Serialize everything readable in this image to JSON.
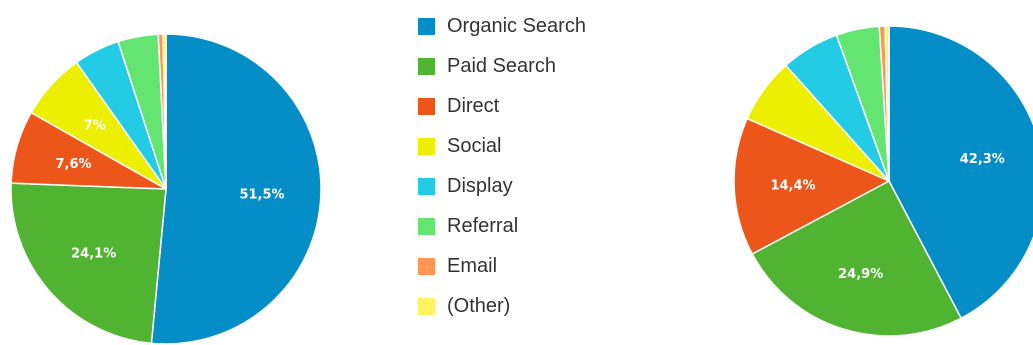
{
  "chart_data": [
    {
      "type": "pie",
      "labels": [
        "Organic Search",
        "Paid Search",
        "Direct",
        "Social",
        "Display",
        "Referral",
        "Email",
        "(Other)"
      ],
      "values": [
        51.5,
        24.1,
        7.6,
        7.0,
        4.8,
        4.2,
        0.5,
        0.3
      ],
      "data_labels": [
        "51,5%",
        "24,1%",
        "7,6%",
        "7%",
        "",
        "",
        "",
        ""
      ],
      "colors": [
        "#058DC7",
        "#50B432",
        "#ED561B",
        "#EDEF00",
        "#24CBE5",
        "#64E572",
        "#FF9655",
        "#FFF263"
      ]
    },
    {
      "type": "pie",
      "labels": [
        "Organic Search",
        "Paid Search",
        "Direct",
        "Social",
        "Display",
        "Referral",
        "Email",
        "(Other)"
      ],
      "values": [
        42.3,
        24.9,
        14.4,
        6.8,
        6.1,
        4.5,
        0.6,
        0.4
      ],
      "data_labels": [
        "42,3%",
        "24,9%",
        "14,4%",
        "",
        "",
        "",
        "",
        ""
      ],
      "colors": [
        "#058DC7",
        "#50B432",
        "#ED561B",
        "#EDEF00",
        "#24CBE5",
        "#64E572",
        "#FF9655",
        "#FFF263"
      ]
    }
  ],
  "legend": {
    "placement": "center",
    "items": [
      {
        "label": "Organic Search",
        "color": "#058DC7"
      },
      {
        "label": "Paid Search",
        "color": "#50B432"
      },
      {
        "label": "Direct",
        "color": "#ED561B"
      },
      {
        "label": "Social",
        "color": "#EDEF00"
      },
      {
        "label": "Display",
        "color": "#24CBE5"
      },
      {
        "label": "Referral",
        "color": "#64E572"
      },
      {
        "label": "Email",
        "color": "#FF9655"
      },
      {
        "label": "(Other)",
        "color": "#FFF263"
      }
    ]
  }
}
